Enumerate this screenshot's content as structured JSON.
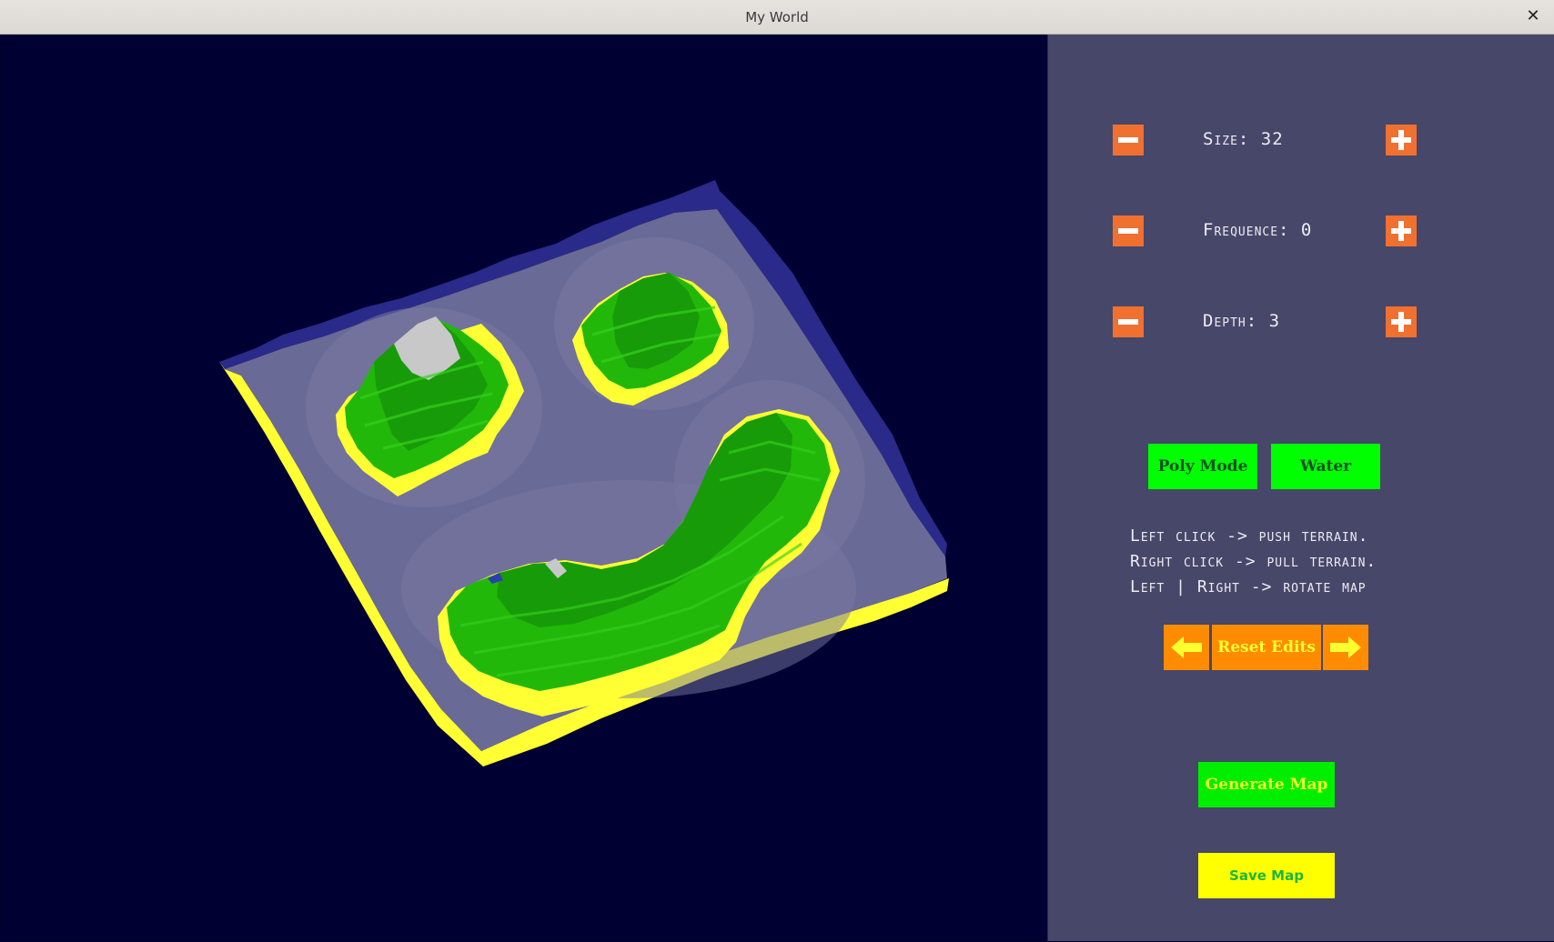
{
  "window": {
    "title": "My World",
    "close_glyph": "✕"
  },
  "controls": {
    "size": {
      "label": "Size: 32"
    },
    "frequence": {
      "label": "Frequence: 0"
    },
    "depth": {
      "label": "Depth: 3"
    }
  },
  "mode_buttons": {
    "poly_mode": "Poly Mode",
    "water": "Water"
  },
  "help_lines": [
    "Left  click -> push terrain.",
    "Right click -> pull terrain.",
    "Left | Right -> rotate map"
  ],
  "reset_edits": "Reset Edits",
  "generate_map": "Generate Map",
  "save_map": "Save Map",
  "icons": {
    "minus": "minus-icon",
    "plus": "plus-icon",
    "arrow_left": "arrow-left-icon",
    "arrow_right": "arrow-right-icon"
  },
  "colors": {
    "viewport_bg": "#000033",
    "panel_bg": "#474769",
    "water": "#6a6a96",
    "grass": "#22b80a",
    "sand": "#ffff33",
    "button_orange": "#f07030",
    "button_green": "#00ff00",
    "button_yellow": "#ffff00"
  }
}
